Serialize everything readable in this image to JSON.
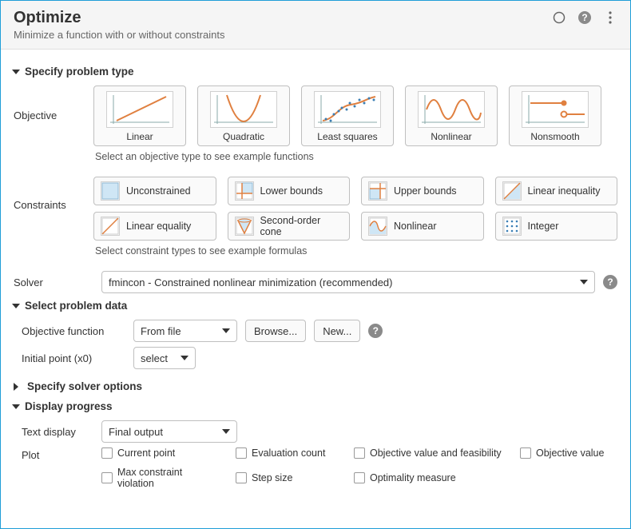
{
  "header": {
    "title": "Optimize",
    "subtitle": "Minimize a function with or without constraints"
  },
  "sections": {
    "specify_problem": "Specify problem type",
    "select_data": "Select problem data",
    "solver_options": "Specify solver options",
    "display_progress": "Display progress"
  },
  "labels": {
    "objective": "Objective",
    "constraints": "Constraints",
    "solver": "Solver",
    "objective_function": "Objective function",
    "initial_point": "Initial point (x0)",
    "text_display": "Text display",
    "plot": "Plot"
  },
  "objective_tiles": [
    {
      "label": "Linear"
    },
    {
      "label": "Quadratic"
    },
    {
      "label": "Least squares"
    },
    {
      "label": "Nonlinear"
    },
    {
      "label": "Nonsmooth"
    }
  ],
  "hints": {
    "objective": "Select an objective type to see example functions",
    "constraints": "Select constraint types to see example formulas"
  },
  "constraint_tiles": [
    {
      "label": "Unconstrained"
    },
    {
      "label": "Lower bounds"
    },
    {
      "label": "Upper bounds"
    },
    {
      "label": "Linear inequality"
    },
    {
      "label": "Linear equality"
    },
    {
      "label": "Second-order cone"
    },
    {
      "label": "Nonlinear"
    },
    {
      "label": "Integer"
    }
  ],
  "solver": {
    "selected": "fmincon - Constrained nonlinear minimization (recommended)"
  },
  "objective_function": {
    "source": "From file",
    "browse": "Browse...",
    "new": "New..."
  },
  "initial_point": {
    "value": "select"
  },
  "text_display": {
    "value": "Final output"
  },
  "plot_options": [
    "Current point",
    "Evaluation count",
    "Objective value and feasibility",
    "Objective value",
    "Max constraint violation",
    "Step size",
    "Optimality measure"
  ]
}
